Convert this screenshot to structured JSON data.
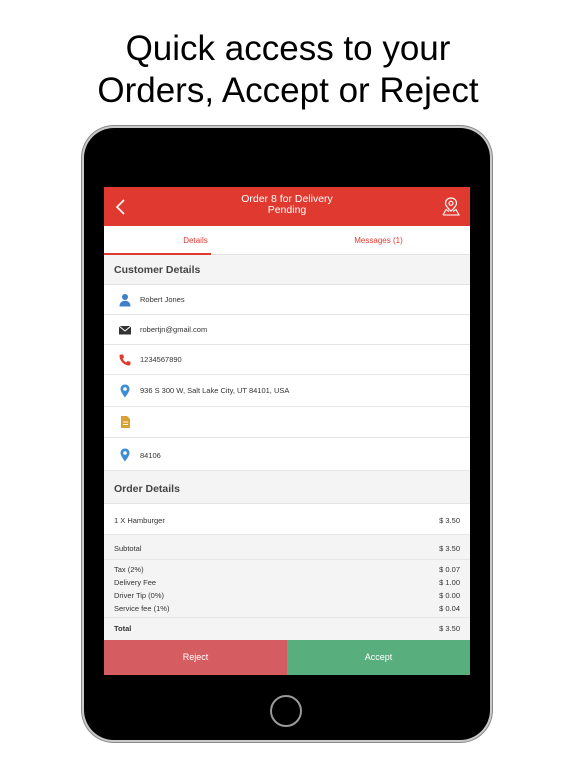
{
  "headline": {
    "line1": "Quick access to your",
    "line2": "Orders, Accept or Reject"
  },
  "header": {
    "title": "Order 8 for Delivery",
    "status": "Pending",
    "back_icon": "chevron-left-icon",
    "map_icon": "map-pin-icon",
    "bg_color": "#e03a30"
  },
  "tabs": [
    {
      "label": "Details",
      "active": true
    },
    {
      "label": "Messages (1)",
      "active": false
    }
  ],
  "customer": {
    "heading": "Customer Details",
    "name": "Robert Jones",
    "email": "robertjn@gmail.com",
    "phone": "1234567890",
    "address": "936 S 300 W, Salt Lake City, UT 84101, USA",
    "note": "",
    "zip": "84106"
  },
  "order": {
    "heading": "Order Details",
    "items": [
      {
        "label": "1 X Hamburger",
        "price": "$ 3.50"
      }
    ],
    "subtotal_label": "Subtotal",
    "subtotal": "$ 3.50",
    "fees": [
      {
        "label": "Tax (2%)",
        "value": "$ 0.07"
      },
      {
        "label": "Delivery Fee",
        "value": "$ 1.00"
      },
      {
        "label": "Driver Tip (0%)",
        "value": "$ 0.00"
      },
      {
        "label": "Service fee (1%)",
        "value": "$ 0.04"
      }
    ],
    "total_label": "Total",
    "total": "$ 3.50"
  },
  "actions": {
    "reject": "Reject",
    "accept": "Accept",
    "reject_color": "#d55d62",
    "accept_color": "#59ae7d"
  }
}
